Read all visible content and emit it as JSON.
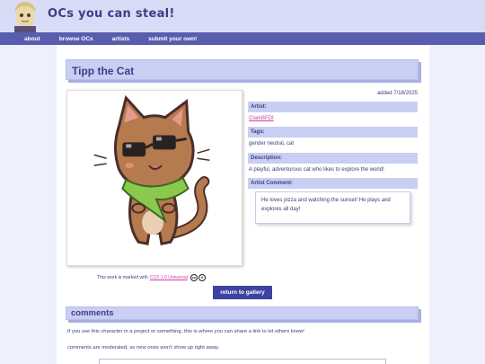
{
  "site": {
    "title": "OCs you can steal!"
  },
  "nav": [
    "about",
    "browse OCs",
    "artists",
    "submit your own!"
  ],
  "character": {
    "name": "Tipp the Cat",
    "added": "added 7/18/2025",
    "labels": {
      "artist": "Artist:",
      "tags": "Tags:",
      "description": "Description:",
      "artist_comment": "Artist Comment:"
    },
    "artist": "ClarkBFDI",
    "tags": "gender neutral, cat",
    "description": "A playful, adventurous cat who likes to explore the world!",
    "artist_comment": "He loves pizza and watching the sunset! He plays and explores all day!"
  },
  "license": {
    "prefix": "This work is marked with",
    "link": "CC0 1.0 Universal"
  },
  "buttons": {
    "back": "return to gallery"
  },
  "comments": {
    "title": "comments",
    "intro": "If you use this character in a project or something, this is where you can share a link to let others know!",
    "note": "comments are moderated, so new ones won't show up right away."
  },
  "colors": {
    "accent": "#585dad",
    "heading_bg": "#c9cef3",
    "link": "#d23ca8",
    "button": "#3d43a0"
  },
  "icons": [
    "cc-icon",
    "cc-zero-icon",
    "mascot-avatar"
  ]
}
